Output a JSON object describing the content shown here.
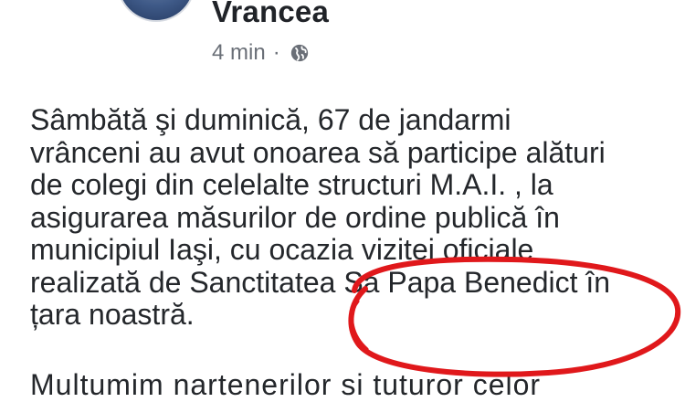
{
  "header": {
    "page_name": "Vrancea",
    "timestamp": "4 min",
    "separator": "·",
    "audience_icon": "globe-icon"
  },
  "post": {
    "lines": [
      "Sâmbătă şi duminică, 67 de jandarmi",
      "vrânceni au avut onoarea să participe alături",
      "de colegi din celelalte structuri M.A.I. , la",
      "asigurarea măsurilor de ordine publică în",
      "municipiul Iaşi, cu ocazia vizitei oficiale",
      "realizată de Sanctitatea Sa Papa Benedict în",
      "țara noastră."
    ],
    "cut_off_line": "Multumim nartenerilor si tuturor celor"
  },
  "annotation": {
    "type": "hand-drawn ellipse",
    "color": "#e0181b"
  }
}
